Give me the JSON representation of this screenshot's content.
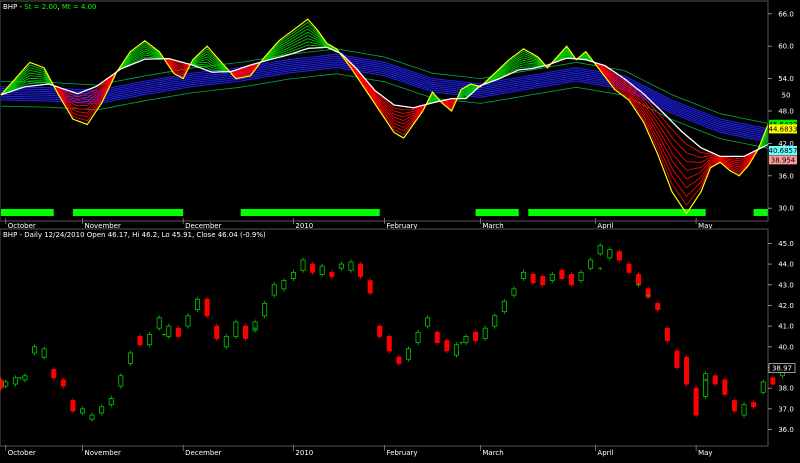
{
  "chart_data": [
    {
      "type": "line",
      "panel": "top",
      "title_parts": [
        {
          "text": "BHP - ",
          "color": "#ffffff"
        },
        {
          "text": "St = 2.00",
          "color": "#00ff00"
        },
        {
          "text": ", ",
          "color": "#ffffff"
        },
        {
          "text": "Mt = 4.00",
          "color": "#00ff00"
        }
      ],
      "ylim": [
        28,
        68
      ],
      "y_ticks": [
        30.0,
        36.0,
        42.0,
        48.0,
        54.0,
        60.0,
        66.0
      ],
      "y_tick_labels": [
        "30.0",
        "36.0",
        "42.0",
        "48.0",
        "54.0",
        "60.0",
        "66.0"
      ],
      "extra_right_labels": [
        {
          "y": 51.0,
          "text": "50"
        }
      ],
      "value_badges": [
        {
          "value": 45.5432,
          "text": "45.5432",
          "bg": "#00ee00",
          "fg": "#000000"
        },
        {
          "value": 44.6833,
          "text": "44.6833",
          "bg": "#ffff00",
          "fg": "#000000"
        },
        {
          "value": 40.6857,
          "text": "40.6857",
          "bg": "#66ffff",
          "fg": "#000000"
        },
        {
          "value": 38.954,
          "text": "38.954",
          "bg": "#ff9999",
          "fg": "#000000"
        }
      ],
      "x_domain": [
        0,
        160
      ],
      "x_tick_labels": [
        {
          "x": 1,
          "text": "October"
        },
        {
          "x": 17,
          "text": "November"
        },
        {
          "x": 38,
          "text": "December"
        },
        {
          "x": 61,
          "text": "2010"
        },
        {
          "x": 80,
          "text": "February"
        },
        {
          "x": 100,
          "text": "March"
        },
        {
          "x": 124,
          "text": "April"
        },
        {
          "x": 145,
          "text": "May"
        }
      ],
      "colors": {
        "short_up": "#ffff00",
        "short_band_up": "#00cc00",
        "short_band_down": "#ff0000",
        "long_band": "#2222ff",
        "long_outer": "#00aa55",
        "fast_line": "#ffffff"
      },
      "fast_line": [
        [
          0,
          51
        ],
        [
          5,
          52.5
        ],
        [
          10,
          53
        ],
        [
          16,
          51.2
        ],
        [
          20,
          52.6
        ],
        [
          25,
          55.8
        ],
        [
          30,
          57.6
        ],
        [
          35,
          57.7
        ],
        [
          40,
          56.5
        ],
        [
          44,
          55.2
        ],
        [
          48,
          55.3
        ],
        [
          52,
          56.5
        ],
        [
          56,
          57.5
        ],
        [
          60,
          58.4
        ],
        [
          64,
          59.6
        ],
        [
          68,
          59.8
        ],
        [
          71,
          58.6
        ],
        [
          74,
          56
        ],
        [
          78,
          51.8
        ],
        [
          82,
          49.1
        ],
        [
          86,
          48.6
        ],
        [
          90,
          49.5
        ],
        [
          94,
          50.3
        ],
        [
          97,
          50.3
        ],
        [
          100,
          52.7
        ],
        [
          104,
          54
        ],
        [
          108,
          55.6
        ],
        [
          111,
          55.9
        ],
        [
          114,
          56.5
        ],
        [
          118,
          57.8
        ],
        [
          122,
          57.5
        ],
        [
          126,
          56.4
        ],
        [
          130,
          54
        ],
        [
          134,
          51.2
        ],
        [
          138,
          47.8
        ],
        [
          142,
          44.2
        ],
        [
          146,
          41.2
        ],
        [
          150,
          39.6
        ],
        [
          155,
          39.6
        ],
        [
          160,
          41.8
        ]
      ],
      "short_line": [
        [
          0,
          51
        ],
        [
          3,
          54
        ],
        [
          6,
          57
        ],
        [
          9,
          56
        ],
        [
          12,
          51
        ],
        [
          15,
          46.5
        ],
        [
          18,
          45.5
        ],
        [
          21,
          49.5
        ],
        [
          24,
          55
        ],
        [
          27,
          59
        ],
        [
          30,
          61
        ],
        [
          33,
          59
        ],
        [
          36,
          55
        ],
        [
          38,
          54
        ],
        [
          40,
          57.5
        ],
        [
          43,
          60
        ],
        [
          46,
          57
        ],
        [
          49,
          54
        ],
        [
          52,
          54.5
        ],
        [
          55,
          58
        ],
        [
          58,
          61
        ],
        [
          61,
          63
        ],
        [
          64,
          65
        ],
        [
          66,
          63
        ],
        [
          68,
          60.5
        ],
        [
          70,
          59.5
        ],
        [
          73,
          56
        ],
        [
          76,
          52
        ],
        [
          79,
          48
        ],
        [
          82,
          44
        ],
        [
          84,
          43
        ],
        [
          86,
          45.5
        ],
        [
          88,
          48
        ],
        [
          90,
          51.5
        ],
        [
          92,
          49.5
        ],
        [
          94,
          48
        ],
        [
          96,
          52
        ],
        [
          98,
          53
        ],
        [
          100,
          52.5
        ],
        [
          103,
          55
        ],
        [
          106,
          57.5
        ],
        [
          109,
          59.5
        ],
        [
          112,
          58
        ],
        [
          114,
          56
        ],
        [
          116,
          58
        ],
        [
          118,
          60
        ],
        [
          120,
          57.5
        ],
        [
          122,
          59
        ],
        [
          125,
          55.5
        ],
        [
          128,
          52
        ],
        [
          131,
          50
        ],
        [
          134,
          46
        ],
        [
          137,
          40
        ],
        [
          140,
          33
        ],
        [
          143,
          29
        ],
        [
          146,
          33
        ],
        [
          148,
          37.5
        ],
        [
          150,
          38.5
        ],
        [
          152,
          37
        ],
        [
          154,
          36
        ],
        [
          156,
          38
        ],
        [
          158,
          41
        ],
        [
          160,
          45.5
        ]
      ],
      "long_line": [
        [
          0,
          52.5
        ],
        [
          10,
          52.3
        ],
        [
          20,
          51.8
        ],
        [
          30,
          53.5
        ],
        [
          40,
          55
        ],
        [
          50,
          56
        ],
        [
          60,
          57.5
        ],
        [
          70,
          58.5
        ],
        [
          80,
          57
        ],
        [
          90,
          54
        ],
        [
          100,
          53
        ],
        [
          110,
          54.5
        ],
        [
          120,
          56
        ],
        [
          130,
          54.5
        ],
        [
          140,
          50
        ],
        [
          150,
          46.5
        ],
        [
          160,
          44.7
        ]
      ],
      "short_ribbon_spread": 0.5,
      "long_ribbon_spread": 0.35,
      "indicator_bars": [
        [
          0,
          11,
          1
        ],
        [
          11,
          15,
          0
        ],
        [
          15,
          38,
          1
        ],
        [
          38,
          50,
          0
        ],
        [
          50,
          79,
          1
        ],
        [
          79,
          99,
          0
        ],
        [
          99,
          108,
          1
        ],
        [
          108,
          110,
          0
        ],
        [
          110,
          147,
          1
        ],
        [
          147,
          157,
          0
        ],
        [
          157,
          160,
          1
        ]
      ]
    },
    {
      "type": "candlestick",
      "panel": "bottom",
      "title_parts": [
        {
          "text": "BHP - Daily 12/24/2010 Open 46.17, Hi 46.2, Lo 45.91, Close 46.04 (-0.9%)",
          "color": "#ffffff"
        }
      ],
      "ylim": [
        35.3,
        45.6
      ],
      "y_ticks": [
        36.0,
        37.0,
        38.0,
        39.0,
        40.0,
        41.0,
        42.0,
        43.0,
        44.0,
        45.0
      ],
      "y_tick_labels": [
        "36.0",
        "37.0",
        "38.0",
        "39.0",
        "40.0",
        "41.0",
        "42.0",
        "43.0",
        "44.0",
        "45.0"
      ],
      "value_badges": [
        {
          "value": 38.97,
          "text": "38.97",
          "bg": "#000000",
          "fg": "#ffffff",
          "border": "#ffffff"
        }
      ],
      "x_domain": [
        0,
        160
      ],
      "x_tick_labels": [
        {
          "x": 1,
          "text": "October"
        },
        {
          "x": 17,
          "text": "November"
        },
        {
          "x": 38,
          "text": "December"
        },
        {
          "x": 61,
          "text": "2010"
        },
        {
          "x": 80,
          "text": "February"
        },
        {
          "x": 100,
          "text": "March"
        },
        {
          "x": 124,
          "text": "April"
        },
        {
          "x": 145,
          "text": "May"
        }
      ],
      "colors": {
        "up": "#00cc00",
        "down": "#ff0000"
      },
      "candles": [
        [
          0,
          38.4,
          38.0
        ],
        [
          1,
          38.1,
          38.3
        ],
        [
          3,
          38.2,
          38.5
        ],
        [
          5,
          38.4,
          38.6
        ],
        [
          7,
          39.7,
          40.0
        ],
        [
          9,
          39.5,
          39.9
        ],
        [
          11,
          38.9,
          38.5
        ],
        [
          13,
          38.4,
          38.1
        ],
        [
          15,
          37.4,
          36.9
        ],
        [
          17,
          36.8,
          37.0
        ],
        [
          19,
          36.5,
          36.7
        ],
        [
          21,
          36.8,
          37.1
        ],
        [
          23,
          37.2,
          37.5
        ],
        [
          25,
          38.1,
          38.6
        ],
        [
          27,
          39.2,
          39.7
        ],
        [
          29,
          40.5,
          40.1
        ],
        [
          31,
          40.1,
          40.6
        ],
        [
          33,
          40.9,
          41.4
        ],
        [
          35,
          40.5,
          41.0
        ],
        [
          37,
          40.9,
          40.5
        ],
        [
          39,
          41.0,
          41.5
        ],
        [
          41,
          41.8,
          42.3
        ],
        [
          43,
          42.3,
          41.5
        ],
        [
          45,
          41.0,
          40.4
        ],
        [
          47,
          40.0,
          40.5
        ],
        [
          49,
          40.5,
          41.2
        ],
        [
          51,
          41.0,
          40.4
        ],
        [
          53,
          40.8,
          41.2
        ],
        [
          55,
          41.5,
          42.1
        ],
        [
          57,
          42.5,
          43.0
        ],
        [
          59,
          42.8,
          43.2
        ],
        [
          61,
          43.3,
          43.6
        ],
        [
          63,
          43.7,
          44.2
        ],
        [
          65,
          44.0,
          43.6
        ],
        [
          67,
          43.5,
          43.9
        ],
        [
          69,
          43.6,
          43.4
        ],
        [
          71,
          43.8,
          44.0
        ],
        [
          73,
          43.7,
          44.1
        ],
        [
          75,
          44.0,
          43.4
        ],
        [
          77,
          43.2,
          42.6
        ],
        [
          79,
          41.0,
          40.5
        ],
        [
          81,
          40.5,
          39.8
        ],
        [
          83,
          39.5,
          39.2
        ],
        [
          85,
          39.4,
          39.9
        ],
        [
          87,
          40.2,
          40.7
        ],
        [
          89,
          41.0,
          41.4
        ],
        [
          91,
          40.7,
          40.2
        ],
        [
          93,
          40.3,
          39.8
        ],
        [
          95,
          39.6,
          40.1
        ],
        [
          97,
          40.2,
          40.5
        ],
        [
          99,
          40.7,
          40.3
        ],
        [
          101,
          40.4,
          40.9
        ],
        [
          103,
          41.0,
          41.5
        ],
        [
          105,
          41.7,
          42.2
        ],
        [
          107,
          42.5,
          42.8
        ],
        [
          109,
          43.3,
          43.6
        ],
        [
          111,
          43.5,
          43.1
        ],
        [
          113,
          43.4,
          43.0
        ],
        [
          115,
          43.2,
          43.5
        ],
        [
          117,
          43.7,
          43.3
        ],
        [
          119,
          43.5,
          43.0
        ],
        [
          121,
          43.2,
          43.6
        ],
        [
          123,
          43.8,
          44.2
        ],
        [
          125,
          44.5,
          44.9
        ],
        [
          127,
          44.3,
          44.7
        ],
        [
          129,
          44.6,
          44.2
        ],
        [
          131,
          44.0,
          43.6
        ],
        [
          133,
          43.5,
          43.0
        ],
        [
          135,
          42.8,
          42.4
        ],
        [
          137,
          42.1,
          41.8
        ],
        [
          139,
          40.9,
          40.3
        ],
        [
          141,
          39.8,
          39.0
        ],
        [
          143,
          39.5,
          38.2
        ],
        [
          145,
          38.0,
          36.7
        ],
        [
          147,
          37.6,
          38.7
        ],
        [
          149,
          38.6,
          38.2
        ],
        [
          151,
          38.4,
          37.7
        ],
        [
          153,
          37.4,
          36.9
        ],
        [
          155,
          36.7,
          37.2
        ],
        [
          157,
          37.3,
          37.1
        ],
        [
          159,
          37.8,
          38.3
        ],
        [
          161,
          38.5,
          38.2
        ],
        [
          163,
          38.6,
          39.0
        ]
      ],
      "marks": [
        [
          4,
          38.5
        ],
        [
          34,
          40.6
        ],
        [
          53,
          40.9
        ],
        [
          96,
          40.2
        ],
        [
          125,
          43.8
        ],
        [
          133,
          43.0
        ],
        [
          135,
          42.5
        ],
        [
          147,
          38.4
        ]
      ]
    }
  ]
}
